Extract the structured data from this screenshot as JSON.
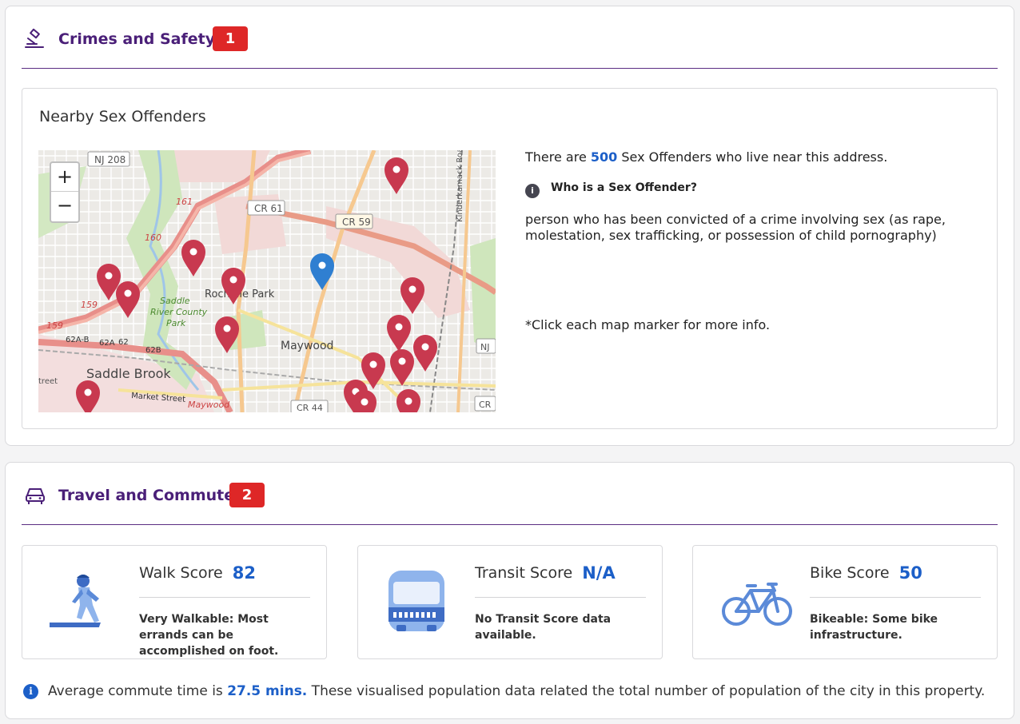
{
  "crime_section": {
    "title": "Crimes and Safety",
    "badge": "1",
    "box_title": "Nearby Sex Offenders",
    "count_prefix": "There are ",
    "count": "500",
    "count_suffix": " Sex Offenders who live near this address.",
    "who_label": "Who is a Sex Offender?",
    "definition": "person who has been convicted of a crime involving sex (as rape, molestation, sex trafficking, or possession of child pornography)",
    "click_note": "*Click each map marker for more info."
  },
  "map": {
    "zoom_in": "+",
    "zoom_out": "−",
    "labels": {
      "nj208": "NJ 208",
      "cr61": "CR 61",
      "cr59": "CR 59",
      "kinderkamack": "Kinderkamack Road",
      "r161": "161",
      "r160": "160",
      "r159a": "159",
      "r159b": "159",
      "rochelle_park": "Rochelle Park",
      "saddle_river_county_park": "Saddle River County Park",
      "saddle_river": "Saddle",
      "river_county": "River County",
      "park": "Park",
      "maywood": "Maywood",
      "maywood_small": "Maywood",
      "saddle_brook": "Saddle Brook",
      "exit62ab": "62A-B",
      "exit62a": "62A",
      "exit62": "62",
      "exit62b": "62B",
      "market_street": "Market Street",
      "cr44": "CR 44",
      "nj": "NJ",
      "cr": "CR",
      "street": "treet"
    },
    "colors": {
      "offender_marker": "#c8394f",
      "address_marker": "#2f7fd1"
    }
  },
  "travel_section": {
    "title": "Travel and Commute",
    "badge": "2",
    "scores": [
      {
        "label": "Walk Score",
        "value": "82",
        "icon": "walker-icon",
        "description": "Very Walkable: Most errands can be accomplished on foot."
      },
      {
        "label": "Transit Score",
        "value": "N/A",
        "icon": "bus-icon",
        "description": "No Transit Score data available."
      },
      {
        "label": "Bike Score",
        "value": "50",
        "icon": "bicycle-icon",
        "description": "Bikeable: Some bike infrastructure."
      }
    ],
    "commute_prefix": "Average commute time is ",
    "commute_value": "27.5 mins.",
    "commute_suffix": " These visualised population data related the total number of population of the city in this property."
  },
  "colors": {
    "accent_purple": "#4a1f78",
    "badge_red": "#de2727",
    "link_blue": "#1c5fc8"
  }
}
